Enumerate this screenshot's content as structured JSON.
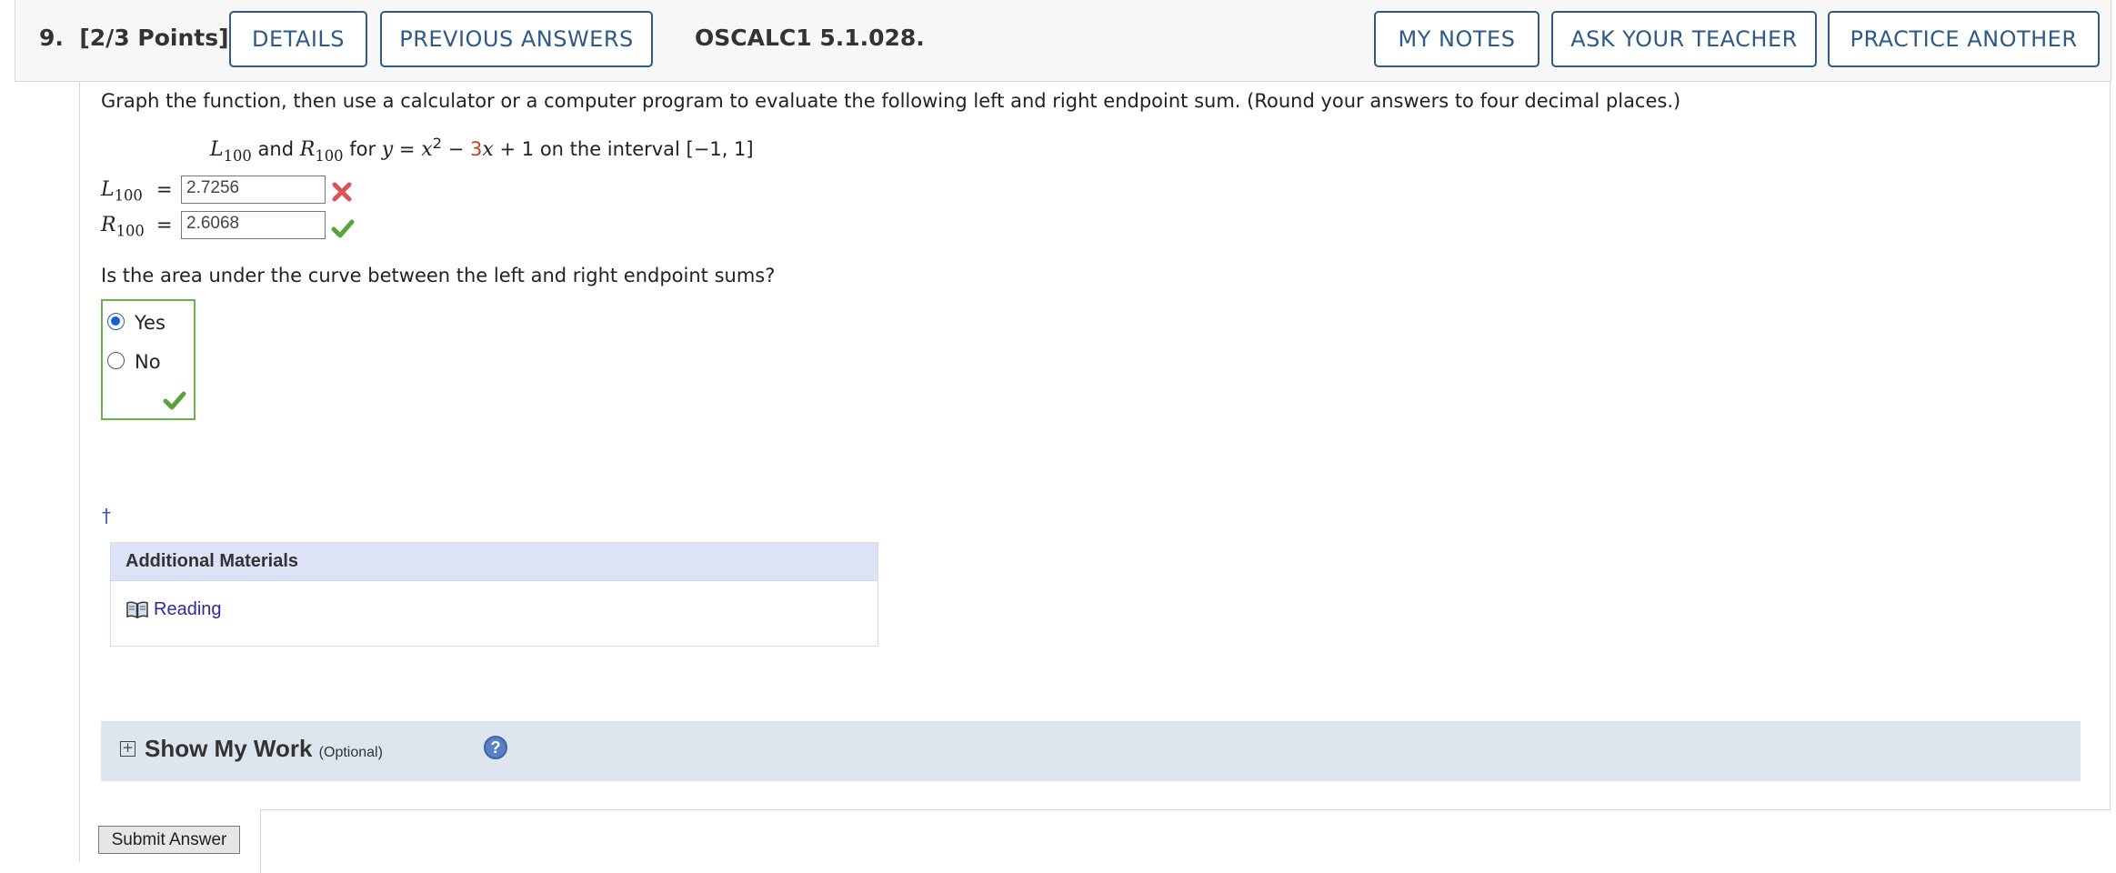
{
  "header": {
    "question_number": "9.",
    "points": "[2/3 Points]",
    "details_button": "DETAILS",
    "previous_answers_button": "PREVIOUS ANSWERS",
    "question_code": "OSCALC1 5.1.028.",
    "my_notes_button": "MY NOTES",
    "ask_teacher_button": "ASK YOUR TEACHER",
    "practice_another_button": "PRACTICE ANOTHER"
  },
  "question": {
    "instructions": "Graph the function, then use a calculator or a computer program to evaluate the following left and right endpoint sum. (Round your answers to four decimal places.)",
    "statement": {
      "L": "L",
      "L_sub": "100",
      "and": "and",
      "R": "R",
      "R_sub": "100",
      "for": "for",
      "y": "y",
      "eq": "=",
      "x": "x",
      "exp": "2",
      "minus": "−",
      "coef": "3",
      "x2": "x",
      "rest": "+ 1 on the interval [−1, 1]"
    },
    "answers": [
      {
        "symbol": "L",
        "subscript": "100",
        "equals": "=",
        "value": "2.7256",
        "status": "incorrect"
      },
      {
        "symbol": "R",
        "subscript": "100",
        "equals": "=",
        "value": "2.6068",
        "status": "correct"
      }
    ],
    "followup": "Is the area under the curve between the left and right endpoint sums?",
    "options": [
      {
        "label": "Yes",
        "selected": true
      },
      {
        "label": "No",
        "selected": false
      }
    ],
    "radio_status": "correct",
    "dagger": "†"
  },
  "additional_materials": {
    "title": "Additional Materials",
    "items": [
      {
        "icon": "book-icon",
        "label": "Reading"
      }
    ]
  },
  "show_my_work": {
    "title": "Show My Work",
    "optional": "(Optional)",
    "help_icon": "?"
  },
  "submit_label": "Submit Answer",
  "colors": {
    "button_blue": "#2e5a88",
    "correct_green": "#6ab04c",
    "incorrect_red": "#e05252",
    "radio_blue": "#1a5fd0",
    "materials_header": "#dde2f6",
    "show_work_bg": "#dde6ef"
  }
}
